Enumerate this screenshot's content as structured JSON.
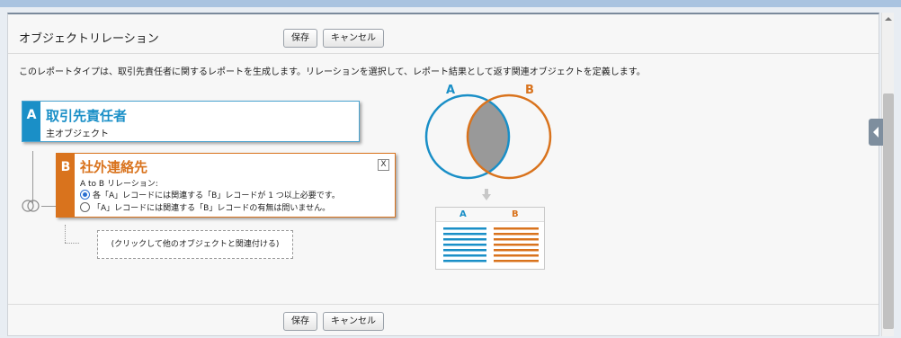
{
  "panel": {
    "title": "オブジェクトリレーション",
    "save_label": "保存",
    "cancel_label": "キャンセル",
    "description": "このレポートタイプは、取引先責任者に関するレポートを生成します。リレーションを選択して、レポート結果として返す関連オブジェクトを定義します。"
  },
  "object_a": {
    "letter": "A",
    "name": "取引先責任者",
    "role": "主オブジェクト",
    "color": "#1a8fc7"
  },
  "object_b": {
    "letter": "B",
    "name": "社外連絡先",
    "relation_label": "A to B リレーション:",
    "close_label": "X",
    "options": [
      {
        "label": "各「A」レコードには関連する「B」レコードが 1 つ以上必要です。",
        "selected": true
      },
      {
        "label": "「A」レコードには関連する「B」レコードの有無は問いません。",
        "selected": false
      }
    ],
    "color": "#d9731d"
  },
  "add_relation_label": "(クリックして他のオブジェクトと関連付ける)",
  "venn": {
    "label_a": "A",
    "label_b": "B"
  },
  "result_table": {
    "col_a": "A",
    "col_b": "B"
  },
  "footer": {
    "save_label": "保存",
    "cancel_label": "キャンセル"
  }
}
